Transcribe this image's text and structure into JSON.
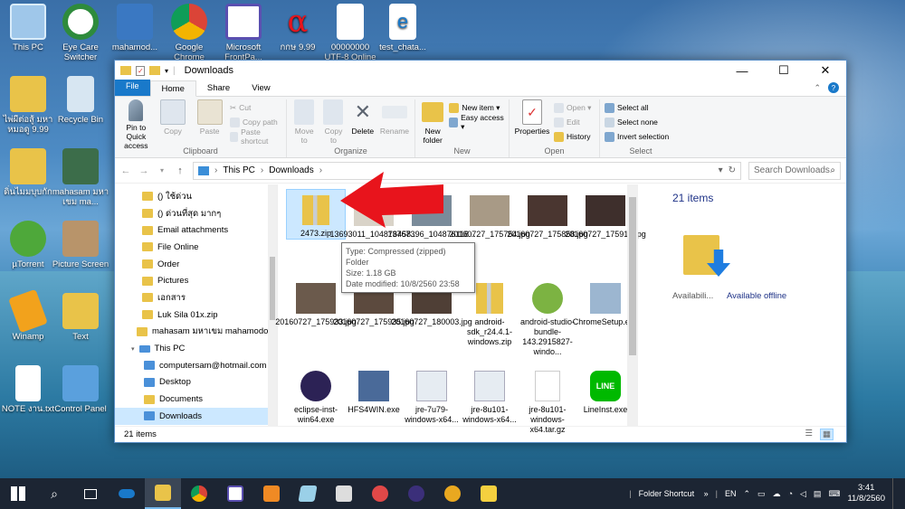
{
  "desktop_icons": [
    {
      "label": "This PC",
      "x": "0"
    },
    {
      "label": "Eye Care Switcher"
    },
    {
      "label": "mahamod..."
    },
    {
      "label": "Google Chrome"
    },
    {
      "label": "Microsoft FrontPa..."
    },
    {
      "label": "กกษ 9.99"
    },
    {
      "label": "00000000 UTF-8 Online"
    },
    {
      "label": "test_chata..."
    },
    {
      "label": "ไพ่ผีต่อสู้ มหา หมอดู 9.99"
    },
    {
      "label": "Recycle Bin"
    },
    {
      "label": "ดิ่นไมมบุบกัก"
    },
    {
      "label": "mahasam มหาเขม ma..."
    },
    {
      "label": "µTorrent"
    },
    {
      "label": "Picture Screen"
    },
    {
      "label": "Winamp"
    },
    {
      "label": "Text"
    },
    {
      "label": "NOTE งาน.txt"
    },
    {
      "label": "Control Panel"
    }
  ],
  "window": {
    "title": "Downloads",
    "minimize": "—",
    "maximize": "☐",
    "close": "✕",
    "tabs": [
      "File",
      "Home",
      "Share",
      "View"
    ],
    "ribbon": {
      "clipboard": {
        "name": "Clipboard",
        "pin": "Pin to Quick access",
        "copy": "Copy",
        "paste": "Paste",
        "cut": "Cut",
        "copy_path": "Copy path",
        "paste_shortcut": "Paste shortcut"
      },
      "organize": {
        "name": "Organize",
        "move_to": "Move to",
        "copy_to": "Copy to",
        "delete": "Delete",
        "rename": "Rename"
      },
      "new": {
        "name": "New",
        "new_folder": "New folder",
        "new_item": "New item ▾",
        "easy_access": "Easy access ▾"
      },
      "open": {
        "name": "Open",
        "properties": "Properties",
        "open": "Open ▾",
        "edit": "Edit",
        "history": "History"
      },
      "select": {
        "name": "Select",
        "select_all": "Select all",
        "select_none": "Select none",
        "invert": "Invert selection"
      }
    },
    "address": {
      "back": "←",
      "forward": "→",
      "up": "↑",
      "path": [
        "This PC",
        "Downloads"
      ],
      "search_placeholder": "Search Downloads"
    },
    "nav": [
      {
        "label": "() ใช้ด่วน"
      },
      {
        "label": "() ด่วนที่สุด มากๆ"
      },
      {
        "label": "Email attachments"
      },
      {
        "label": "File Online"
      },
      {
        "label": "Order"
      },
      {
        "label": "Pictures"
      },
      {
        "label": "เอกสาร"
      },
      {
        "label": "Luk Sila 01x.zip"
      },
      {
        "label": "mahasam มหาเขม mahamodo."
      },
      {
        "label": "This PC"
      },
      {
        "label": "computersam@hotmail.com"
      },
      {
        "label": "Desktop"
      },
      {
        "label": "Documents"
      },
      {
        "label": "Downloads"
      }
    ],
    "files": [
      {
        "name": "2473.zip"
      },
      {
        "name": "13693011_104876458..."
      },
      {
        "name": "13767396_104876118..."
      },
      {
        "name": "20160727_175754.jpg"
      },
      {
        "name": "20160727_175858.jpg"
      },
      {
        "name": "20160727_175917.jpg"
      },
      {
        "name": "20160727_175933.jpg"
      },
      {
        "name": "20160727_175935.jpg"
      },
      {
        "name": "20160727_180003.jpg"
      },
      {
        "name": "android-sdk_r24.4.1-windows.zip"
      },
      {
        "name": "android-studio-bundle-143.2915827-windo..."
      },
      {
        "name": "ChromeSetup.exe"
      },
      {
        "name": "eclipse-inst-win64.exe"
      },
      {
        "name": "HFS4WIN.exe"
      },
      {
        "name": "jre-7u79-windows-x64..."
      },
      {
        "name": "jre-8u101-windows-x64..."
      },
      {
        "name": "jre-8u101-windows-x64.tar.gz"
      },
      {
        "name": "LineInst.exe"
      }
    ],
    "tooltip": {
      "type": "Type: Compressed (zipped) Folder",
      "size": "Size: 1.18 GB",
      "modified": "Date modified: 10/8/2560 23:58"
    },
    "preview": {
      "count": "21 items",
      "availability": "Availabili...",
      "available_offline": "Available offline"
    },
    "status": "21 items"
  },
  "taskbar": {
    "tray_label": "Folder Shortcut",
    "lang": "EN",
    "time": "3:41",
    "date": "11/8/2560"
  },
  "colors": {
    "accent": "#1979ca",
    "selection": "#cce8ff",
    "arrow": "#e8141c"
  }
}
